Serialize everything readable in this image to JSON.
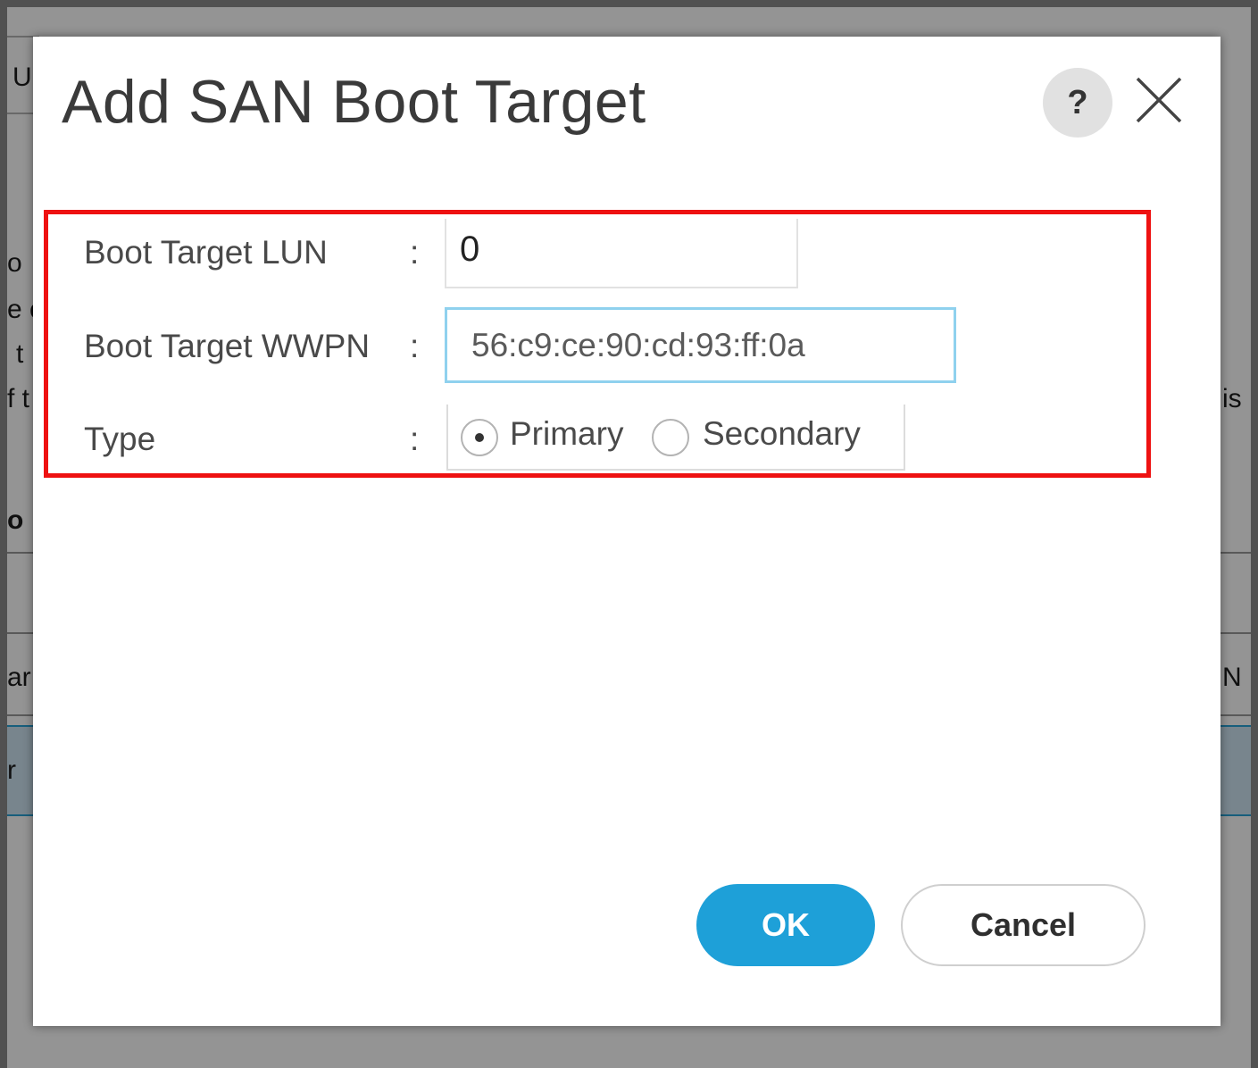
{
  "dialog": {
    "title": "Add SAN Boot Target",
    "help_label": "?",
    "help_icon": "help-icon",
    "close_icon": "close-icon",
    "highlight_color": "#ee1111"
  },
  "form": {
    "lun": {
      "label": "Boot Target LUN",
      "colon": ":",
      "value": "0"
    },
    "wwpn": {
      "label": "Boot Target WWPN",
      "colon": ":",
      "value": "56:c9:ce:90:cd:93:ff:0a"
    },
    "type": {
      "label": "Type",
      "colon": ":",
      "options": [
        {
          "label": "Primary",
          "checked": true
        },
        {
          "label": "Secondary",
          "checked": false
        }
      ]
    }
  },
  "buttons": {
    "ok": "OK",
    "cancel": "Cancel"
  },
  "background": {
    "fragments": [
      "U",
      "o",
      "e c",
      "t",
      "f t",
      "o",
      "ar",
      "r",
      "is",
      "N"
    ]
  },
  "colors": {
    "primary_button": "#1ea0d8",
    "focus_border": "#8fd1ee",
    "overlay": "#8c8c8c"
  }
}
